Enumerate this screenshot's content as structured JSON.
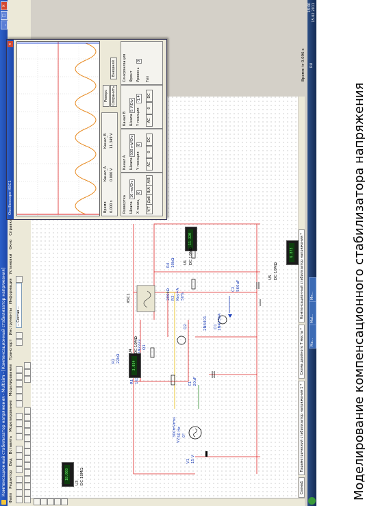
{
  "caption": "Моделирование компенсационного стабилизатора напряжения",
  "window": {
    "title": "Компенсационный стабилизатор напряжения - Multisim - [Компенсационный стабилизатор напряжения]"
  },
  "menu": [
    "Файл",
    "Редактор",
    "Вид",
    "Вставить",
    "Моделирование",
    "Моделирование",
    "Транспорт",
    "Инструменты",
    "Информация",
    "Установки",
    "Окно",
    "Справка"
  ],
  "toolbar": {
    "dropdown": "-- Состав --"
  },
  "doc_tabs": [
    "Схема1",
    "Параметрический стабилизатор напряжения 1 *",
    "Схема двойного Т моста *",
    "Компенсационный стабилизатор напряжения *"
  ],
  "components": {
    "xsc1": "XSC1",
    "v1": [
      "V1",
      "15 V"
    ],
    "v2": [
      "V2",
      "300mVrms",
      "50 Hz",
      "0°"
    ],
    "q1": [
      "Q1",
      "2N2222"
    ],
    "q2": [
      "Q2",
      "2N4401"
    ],
    "r1": [
      "R1",
      "1kΩ"
    ],
    "r2": [
      "R2",
      "22kΩ"
    ],
    "r3": [
      "R3",
      "200kΩ",
      "Key=A",
      "50%"
    ],
    "r4": [
      "R4",
      "10kΩ"
    ],
    "c1": [
      "C1",
      "20uF"
    ],
    "c2": [
      "C2",
      "560uF"
    ],
    "d1": [
      "D1",
      "1N4736A"
    ]
  },
  "meters": {
    "u1": {
      "name": "U1",
      "spec": "DC 10MΩ",
      "value": "11.320"
    },
    "u3": {
      "name": "U3",
      "spec": "DC 10MΩ",
      "value": "18.003"
    },
    "u4": {
      "name": "U4",
      "spec": "DC 10MΩ",
      "value": "3.054"
    },
    "u5": {
      "name": "U5",
      "spec": "DC 10MΩ",
      "value": "6.873"
    }
  },
  "oscilloscope": {
    "title": "Oscilloscope-XSC1",
    "readouts": {
      "time_label": "Время",
      "time": "0.000 s",
      "chA_label": "Канал_A",
      "chA": "0.000 V",
      "chB_label": "Канал_B",
      "chB": "11.349 V"
    },
    "buttons": {
      "reverse": "Реверс",
      "save": "Сохранить",
      "ext_trigger": "Внешний"
    },
    "timebase": {
      "label": "Развертка",
      "scale": "Шкала",
      "scale_val": "10 ms/Div",
      "xpos": "X позиц",
      "xpos_val": "0"
    },
    "chanA": {
      "label": "Канал A",
      "scale": "Шкала",
      "scale_val": "500 mV/Div",
      "ypos": "Y позиция",
      "ypos_val": "0"
    },
    "chanB": {
      "label": "Канал B",
      "scale": "Шкала",
      "scale_val": "5 V/Div",
      "ypos": "Y позиция",
      "ypos_val": "-1.4"
    },
    "trigger": {
      "label": "Синхронизация",
      "edge": "Фронт",
      "level": "Уровень",
      "level_val": "0",
      "type": "Тип"
    },
    "modes": [
      "Y/T",
      "Доб",
      "B/A",
      "A/B"
    ],
    "coupling": [
      "AC",
      "0",
      "DC"
    ]
  },
  "status": {
    "time": "Время: tr 0.096 s"
  },
  "taskbar": {
    "items": [
      "Ма...",
      "Mul...",
      "Мп..."
    ],
    "lang": "RU",
    "clock_time": "18:46",
    "clock_date": "15.02.2011"
  }
}
